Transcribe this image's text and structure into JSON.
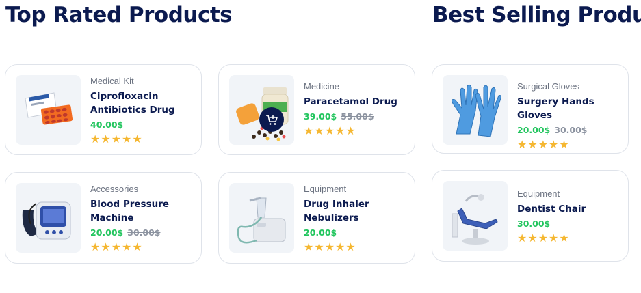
{
  "top_rated": {
    "title": "Top Rated Products",
    "products": [
      {
        "category": "Medical Kit",
        "name_line1": "Ciprofloxacin",
        "name_line2": "Antibiotics Drug",
        "price": "40.00$",
        "old_price": "",
        "stars": "★★★★★",
        "icon": "antibiotic-box-image"
      },
      {
        "category": "Medicine",
        "name_line1": "Paracetamol Drug",
        "name_line2": "",
        "price": "39.00$",
        "old_price": "55.00$",
        "stars": "★★★★★",
        "icon": "pills-bottle-image"
      },
      {
        "category": "Accessories",
        "name_line1": "Blood Pressure",
        "name_line2": "Machine",
        "price": "20.00$",
        "old_price": "30.00$",
        "stars": "★★★★★",
        "icon": "blood-pressure-monitor-image"
      },
      {
        "category": "Equipment",
        "name_line1": "Drug Inhaler",
        "name_line2": "Nebulizers",
        "price": "20.00$",
        "old_price": "",
        "stars": "★★★★★",
        "icon": "nebulizer-image"
      }
    ]
  },
  "best_selling": {
    "title": "Best Selling Produc",
    "products": [
      {
        "category": "Surgical Gloves",
        "name_line1": "Surgery Hands Gloves",
        "name_line2": "",
        "price": "20.00$",
        "old_price": "30.00$",
        "stars": "★★★★★",
        "icon": "gloves-image"
      },
      {
        "category": "Equipment",
        "name_line1": "Dentist Chair",
        "name_line2": "",
        "price": "30.00$",
        "old_price": "",
        "stars": "★★★★★",
        "icon": "dentist-chair-image"
      }
    ]
  },
  "colors": {
    "heading": "#0b1a4f",
    "price": "#22c55e",
    "star": "#f5b731",
    "old_price": "#8c93a0"
  },
  "cart_icon": "add-to-cart-icon"
}
